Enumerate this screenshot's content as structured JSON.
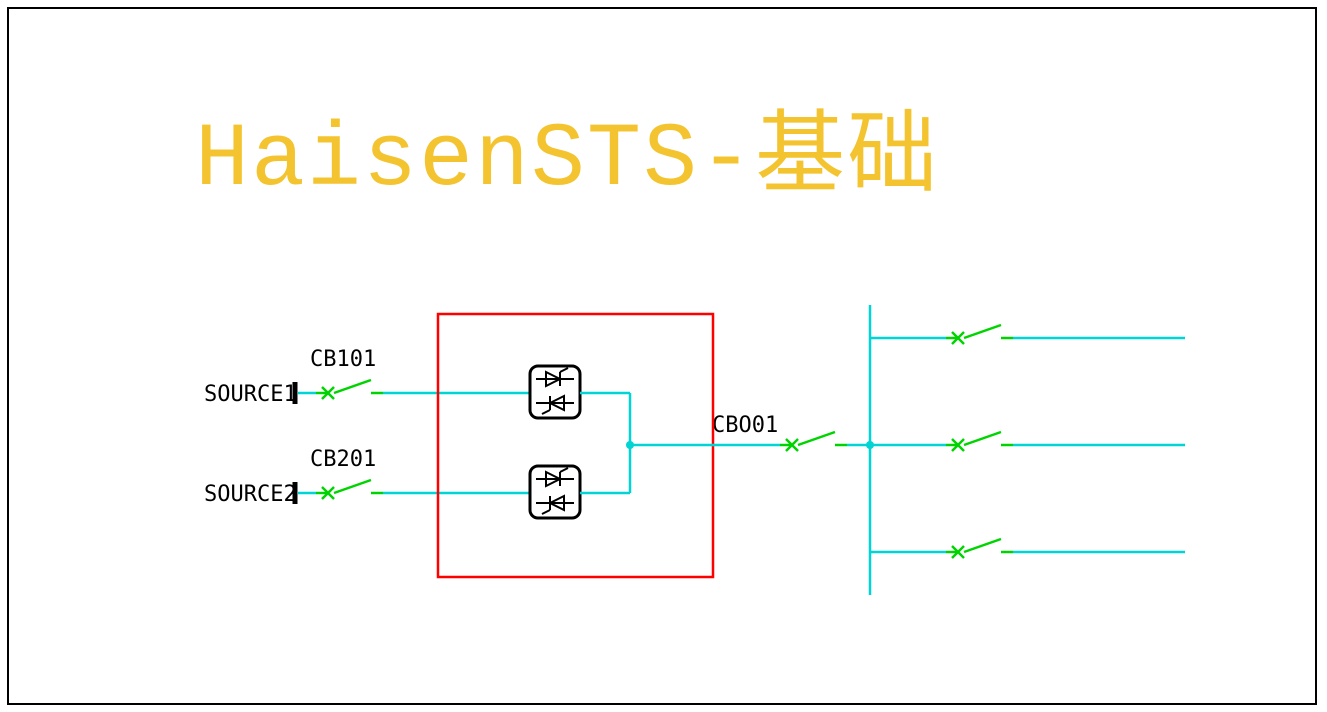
{
  "title": "HaisenSTS-基础",
  "labels": {
    "source1": "SOURCE1",
    "source2": "SOURCE2",
    "cb101": "CB101",
    "cb201": "CB201",
    "cbo01": "CBO01"
  },
  "colors": {
    "wire": "#00d4d4",
    "breaker": "#00d400",
    "box": "#ff0000",
    "title": "#f4c430"
  }
}
